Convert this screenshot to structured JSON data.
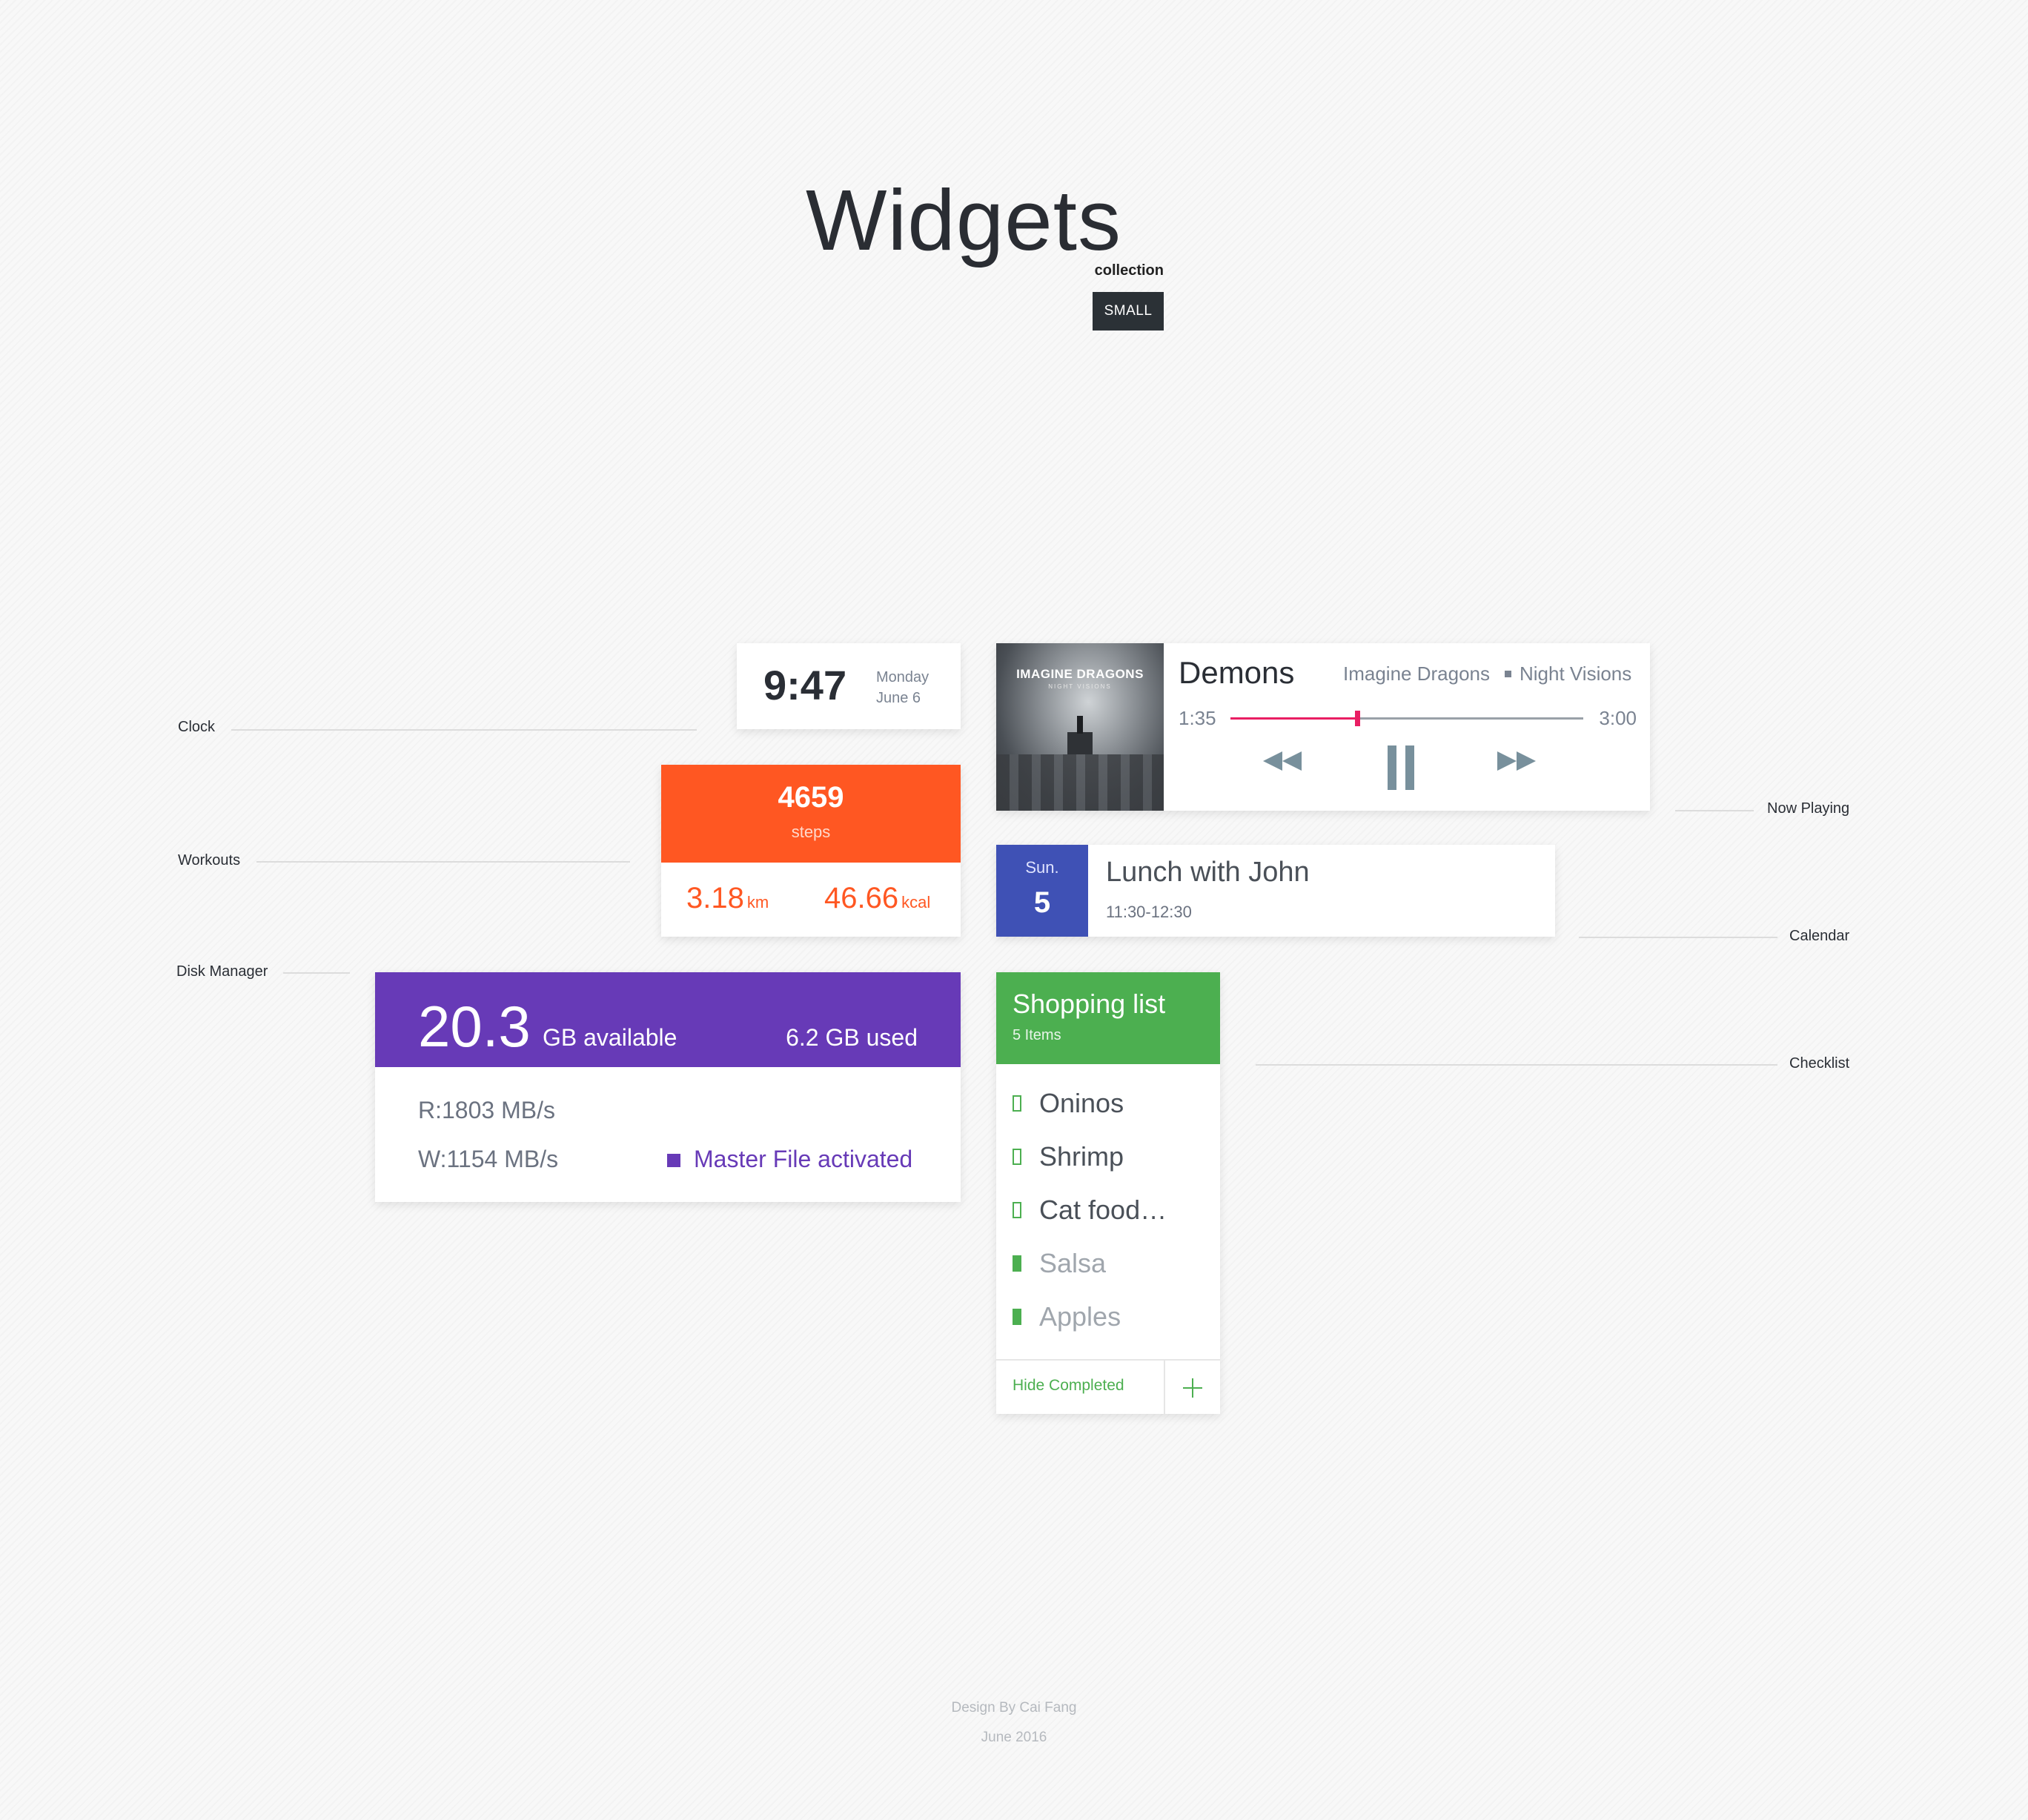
{
  "header": {
    "title": "Widgets",
    "subtitle": "collection",
    "size_badge": "SMALL"
  },
  "labels": {
    "clock": "Clock",
    "workouts": "Workouts",
    "disk_manager": "Disk Manager",
    "now_playing": "Now Playing",
    "calendar": "Calendar",
    "checklist": "Checklist"
  },
  "clock": {
    "time": "9:47",
    "day": "Monday",
    "date": "June 6"
  },
  "workouts": {
    "steps": "4659",
    "steps_label": "steps",
    "distance": "3.18",
    "distance_unit": "km",
    "calories": "46.66",
    "calories_unit": "kcal",
    "accent_color": "#ff5722"
  },
  "disk": {
    "available": "20.3",
    "available_label": "GB available",
    "used": "6.2 GB used",
    "read": "R:1803 MB/s",
    "write": "W:1154 MB/s",
    "status": "Master File activated",
    "accent_color": "#673ab7"
  },
  "now_playing": {
    "song": "Demons",
    "artist": "Imagine Dragons",
    "album": "Night Visions",
    "album_art_text": "IMAGINE DRAGONS",
    "album_art_subtext": "NIGHT VISIONS",
    "elapsed": "1:35",
    "total": "3:00",
    "progress": 0.36,
    "icons": {
      "rewind": "rewind-icon",
      "pause": "pause-icon",
      "forward": "fast-forward-icon"
    },
    "accent_color": "#e91e63"
  },
  "calendar": {
    "day_of_week": "Sun.",
    "day": "5",
    "event": "Lunch with John",
    "time": "11:30-12:30",
    "accent_color": "#3f51b5"
  },
  "checklist": {
    "title": "Shopping list",
    "count": "5 Items",
    "items": [
      {
        "label": "Oninos",
        "done": false
      },
      {
        "label": "Shrimp",
        "done": false
      },
      {
        "label": "Cat food…",
        "done": false
      },
      {
        "label": "Salsa",
        "done": true
      },
      {
        "label": "Apples",
        "done": true
      }
    ],
    "hide_completed": "Hide Completed",
    "add_icon": "plus-icon",
    "accent_color": "#4caf50"
  },
  "footer": {
    "credit": "Design By Cai Fang",
    "date": "June 2016"
  }
}
